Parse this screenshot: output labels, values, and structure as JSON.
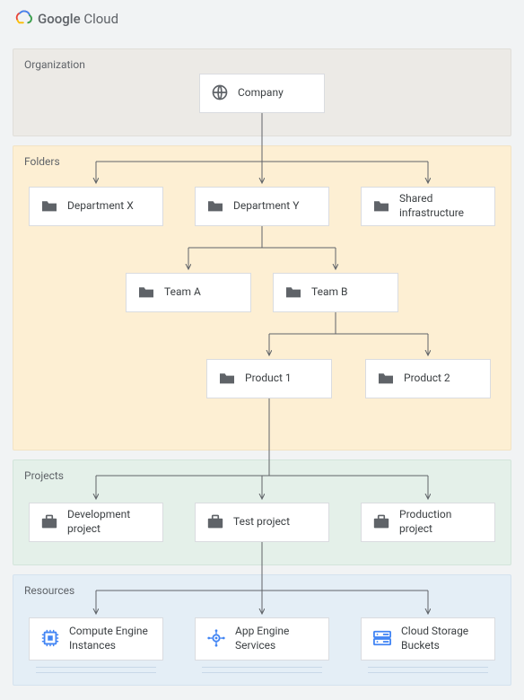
{
  "brand": {
    "word1": "Google",
    "word2": "Cloud"
  },
  "sections": {
    "organization": {
      "label": "Organization",
      "bg": "#eceae6",
      "border": "#e0ded9"
    },
    "folders": {
      "label": "Folders",
      "bg": "#fdefd3",
      "border": "#f2e3c4"
    },
    "projects": {
      "label": "Projects",
      "bg": "#e4f0e9",
      "border": "#d3e5da"
    },
    "resources": {
      "label": "Resources",
      "bg": "#e4eef6",
      "border": "#d4e2ee"
    }
  },
  "nodes": {
    "company": {
      "label": "Company"
    },
    "deptX": {
      "label": "Department X"
    },
    "deptY": {
      "label": "Department Y"
    },
    "sharedInfra": {
      "label": "Shared infrastructure"
    },
    "teamA": {
      "label": "Team A"
    },
    "teamB": {
      "label": "Team B"
    },
    "product1": {
      "label": "Product 1"
    },
    "product2": {
      "label": "Product 2"
    },
    "devProj": {
      "label": "Development project"
    },
    "testProj": {
      "label": "Test project"
    },
    "prodProj": {
      "label": "Production project"
    },
    "compute": {
      "label": "Compute Engine Instances"
    },
    "appEngine": {
      "label": "App Engine Services"
    },
    "storage": {
      "label": "Cloud Storage Buckets"
    }
  },
  "colors": {
    "line": "#5f6368",
    "folderIcon": "#5f6368",
    "globeIcon": "#5f6368",
    "briefcaseIcon": "#5f6368",
    "computeIcon": "#4285f4",
    "appEngineIcon": "#4285f4",
    "storageIcon": "#4285f4"
  }
}
